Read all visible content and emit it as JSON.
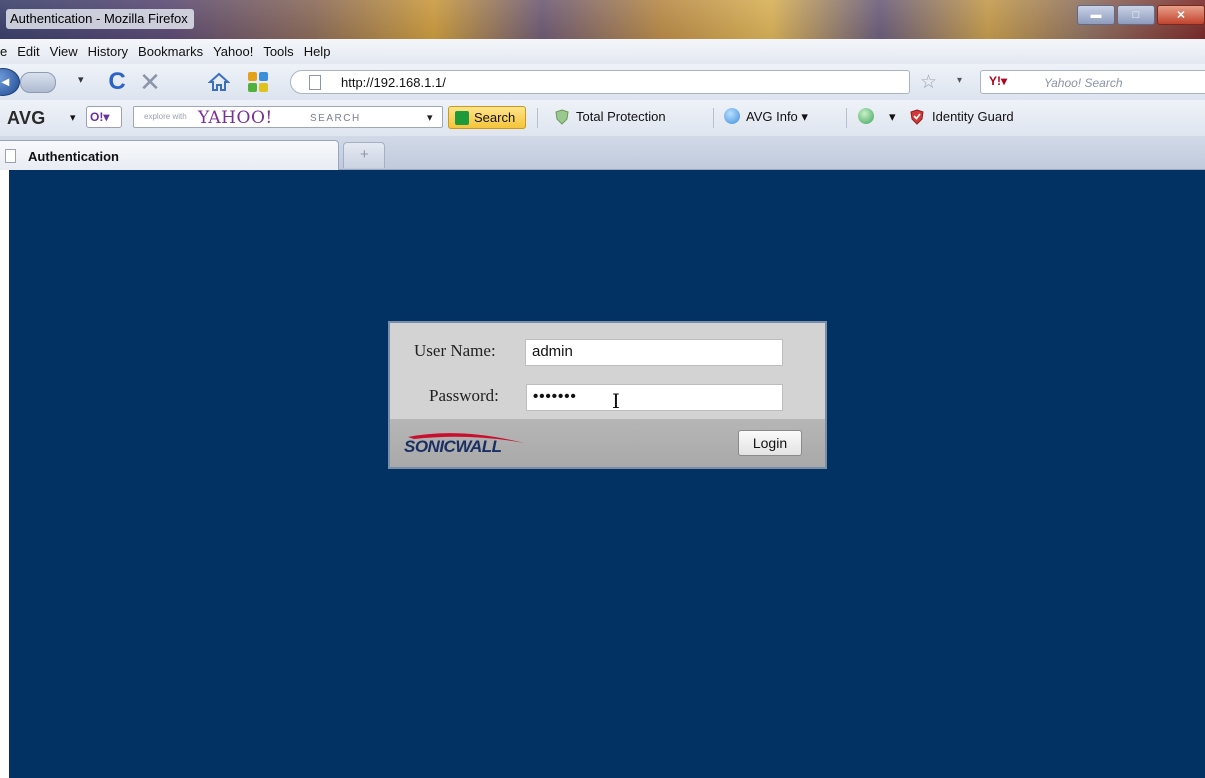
{
  "window": {
    "title": "Authentication - Mozilla Firefox",
    "min_glyph": "▬",
    "max_glyph": "□",
    "close_glyph": "✕"
  },
  "menu": {
    "items": [
      "e",
      "Edit",
      "View",
      "History",
      "Bookmarks",
      "Yahoo!",
      "Tools",
      "Help"
    ]
  },
  "navbar": {
    "url": "http://192.168.1.1/",
    "search_placeholder": "Yahoo! Search",
    "yahoo_badge": "Y!▾",
    "fwd_dd": "▾",
    "star_dd": "▾"
  },
  "avg_toolbar": {
    "logo": "AVG",
    "logo_dd": "▾",
    "o_badge": "O!▾",
    "explore_text": "explore with",
    "yahoo_logo": "YAHOO!",
    "search_label": "SEARCH",
    "search_dd": "▾",
    "search_button": "Search",
    "total_protection": "Total Protection",
    "avg_info": "AVG Info ▾",
    "more_dd": "▾",
    "identity_guard": "Identity Guard"
  },
  "tabs": {
    "active_label": "Authentication",
    "new_tab_glyph": "+"
  },
  "login": {
    "username_label": "User Name:",
    "username_value": "admin",
    "password_label": "Password:",
    "password_value": "•••••••",
    "cursor_glyph": "I",
    "brand": "SONICWALL",
    "button_label": "Login"
  },
  "colors": {
    "content_background": "#023264",
    "panel_background": "#d3d3d3",
    "panel_footer": "#b0b0b0",
    "brand_blue": "#1a2f63",
    "brand_red": "#c8102e"
  },
  "icons": {
    "back": "back-arrow-icon",
    "reload": "reload-icon",
    "stop": "stop-icon",
    "home": "home-icon",
    "apps": "apps-grid-icon",
    "bookmark": "star-icon",
    "shield": "identity-shield-icon"
  }
}
